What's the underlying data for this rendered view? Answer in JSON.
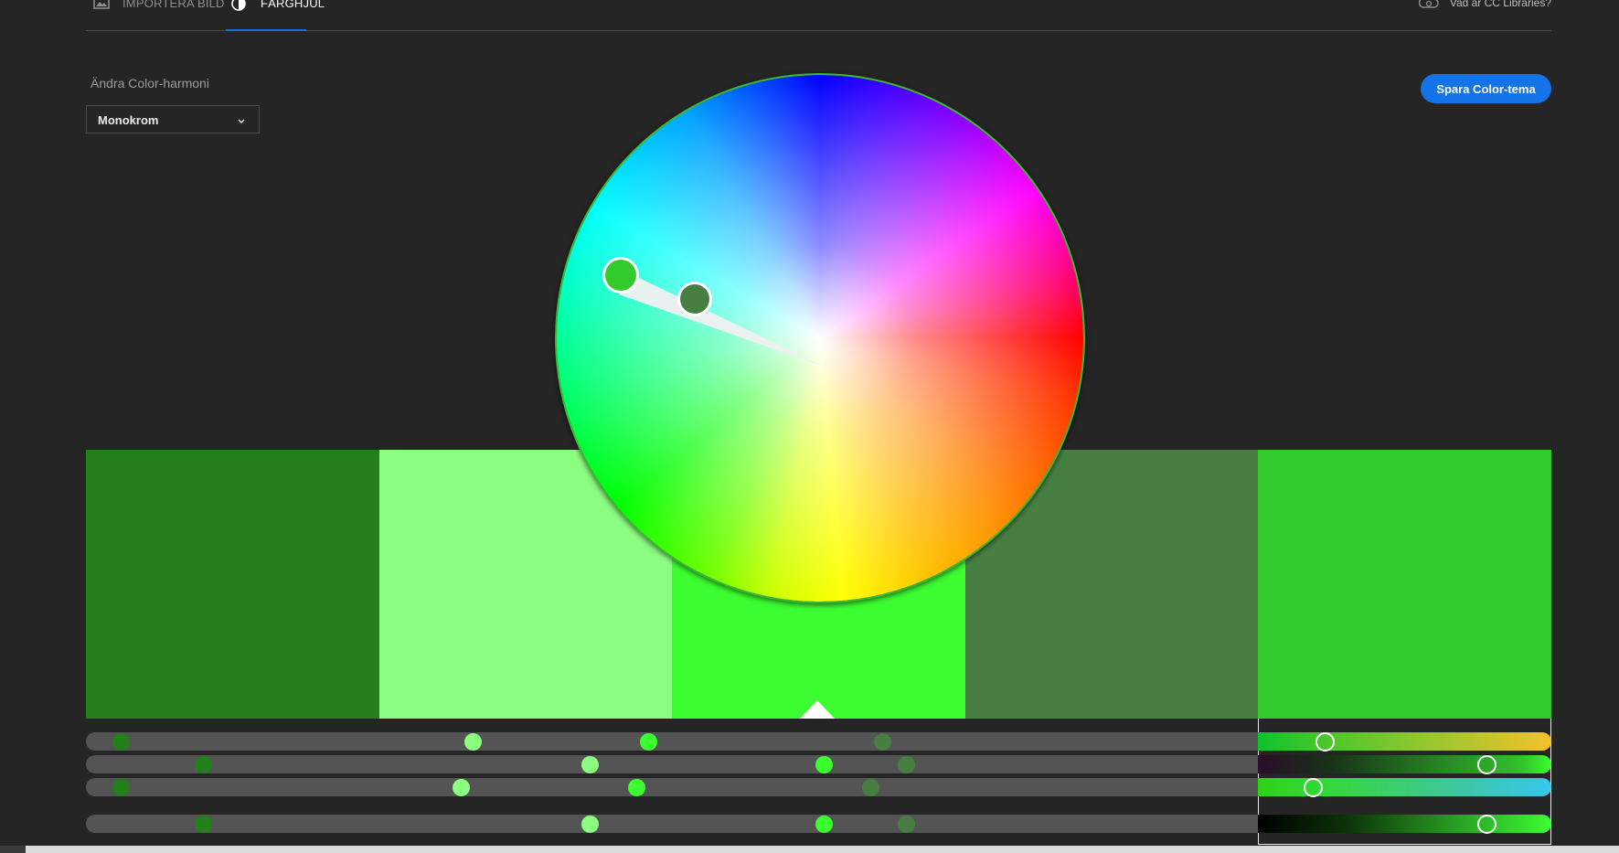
{
  "nav": {
    "tabs": [
      {
        "label": "IMPORTERA BILD",
        "icon": "image-icon"
      },
      {
        "label": "FÄRGHJUL",
        "icon": "color-wheel-icon"
      }
    ],
    "active_tab": "FÄRGHJUL",
    "cc_link": {
      "label": "Vad är CC Libraries?",
      "icon": "creative-cloud-icon"
    }
  },
  "harmony": {
    "label": "Ändra Color-harmoni",
    "selected": "Monokrom"
  },
  "save_button": {
    "label": "Spara Color-tema"
  },
  "colors": {
    "accent": "#1473e6",
    "background": "#252525"
  },
  "swatches": [
    {
      "hex": "#237f1a"
    },
    {
      "hex": "#8bfd80"
    },
    {
      "hex": "#3cfd30"
    },
    {
      "hex": "#477f42"
    },
    {
      "hex": "#33cb2b",
      "selected": true
    }
  ],
  "base_swatch_index": 2,
  "selected_swatch_index": 4,
  "sliders": [
    {
      "name": "hue",
      "dots": [
        0.03,
        0.33,
        0.48,
        0.68
      ],
      "selected_value": 0.23
    },
    {
      "name": "saturation",
      "dots": [
        0.1,
        0.43,
        0.63,
        0.7
      ],
      "selected_value": 0.78
    },
    {
      "name": "brightness",
      "dots": [
        0.03,
        0.32,
        0.47,
        0.67
      ],
      "selected_value": 0.19
    },
    {
      "name": "value",
      "dots": [
        0.1,
        0.43,
        0.63,
        0.7
      ],
      "selected_value": 0.78
    }
  ]
}
